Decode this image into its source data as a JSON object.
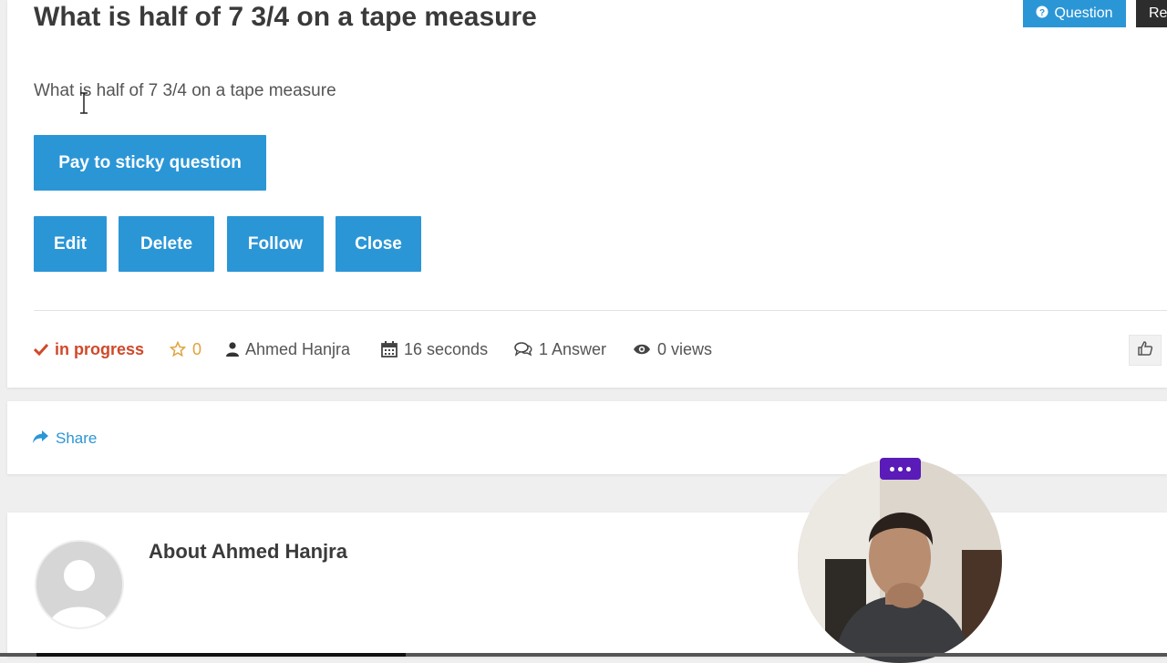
{
  "question": {
    "title": "What is half of 7 3/4 on a tape measure",
    "body": "What is half of 7 3/4 on a tape measure",
    "sticky_button": "Pay to sticky question",
    "actions": {
      "edit": "Edit",
      "delete": "Delete",
      "follow": "Follow",
      "close": "Close"
    },
    "meta": {
      "status": "in progress",
      "favorites": "0",
      "author": "Ahmed Hanjra",
      "date": "16 seconds",
      "answers": "1 Answer",
      "views": "0 views"
    },
    "badge_question": "Question",
    "badge_report": "Re"
  },
  "share": {
    "label": "Share"
  },
  "about": {
    "title": "About Ahmed Hanjra"
  },
  "icons": {
    "status": "check-icon",
    "favorites": "star-icon",
    "author": "user-icon",
    "date": "calendar-icon",
    "answers": "comments-icon",
    "views": "eye-icon",
    "share": "share-arrow-icon",
    "vote": "thumbs-up-icon",
    "question_badge": "question-circle-icon"
  },
  "colors": {
    "primary": "#2b96d6",
    "status": "#d0492b",
    "favorite": "#e0a33b",
    "webcam_menu": "#5a1bb8"
  }
}
